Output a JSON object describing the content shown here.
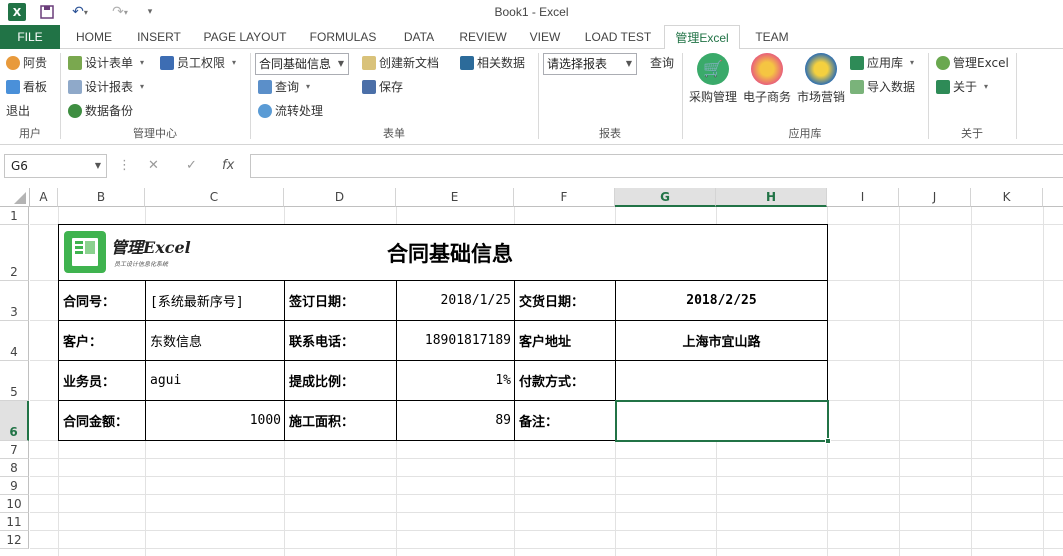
{
  "app": {
    "title": "Book1 - Excel"
  },
  "quick_access": {
    "excel_logo": "X",
    "save_icon": "save-icon",
    "undo_icon": "undo-icon",
    "redo_icon": "redo-icon",
    "customize_icon": "▾"
  },
  "tabs": [
    {
      "label": "FILE"
    },
    {
      "label": "HOME"
    },
    {
      "label": "INSERT"
    },
    {
      "label": "PAGE LAYOUT"
    },
    {
      "label": "FORMULAS"
    },
    {
      "label": "DATA"
    },
    {
      "label": "REVIEW"
    },
    {
      "label": "VIEW"
    },
    {
      "label": "LOAD TEST"
    },
    {
      "label": "管理Excel"
    },
    {
      "label": "TEAM"
    }
  ],
  "ribbon": {
    "user": {
      "btn1": "阿贵",
      "btn2": "看板",
      "btn3": "退出",
      "label": "用户"
    },
    "mgmt": {
      "design_form": "设计表单",
      "design_report": "设计报表",
      "backup": "数据备份",
      "permissions": "员工权限",
      "label": "管理中心"
    },
    "form": {
      "combo": "合同基础信息",
      "query": "查询",
      "flow": "流转处理",
      "new_doc": "创建新文档",
      "save": "保存",
      "related": "相关数据",
      "label": "表单"
    },
    "report": {
      "combo": "请选择报表",
      "query": "查询",
      "label": "报表"
    },
    "apps": {
      "purchase": "采购管理",
      "ecommerce": "电子商务",
      "marketing": "市场营销",
      "applib": "应用库",
      "import": "导入数据",
      "label": "应用库"
    },
    "about": {
      "manage_excel": "管理Excel",
      "about": "关于",
      "label": "关于"
    }
  },
  "formula_bar": {
    "name_box": "G6",
    "cancel_icon": "✕",
    "enter_icon": "✓",
    "fx": "fx",
    "content": ""
  },
  "columns": [
    "A",
    "B",
    "C",
    "D",
    "E",
    "F",
    "G",
    "H",
    "I",
    "J",
    "K"
  ],
  "rows": [
    "1",
    "2",
    "3",
    "4",
    "5",
    "6",
    "7",
    "8",
    "9",
    "10",
    "11",
    "12"
  ],
  "sheet": {
    "logo_text": "管理Excel",
    "logo_sub": "员工设计信息化系统",
    "title": "合同基础信息",
    "r3": {
      "b": "合同号：",
      "c": "[系统最新序号]",
      "d": "签订日期：",
      "e": "2018/1/25",
      "f": "交货日期：",
      "gh": "2018/2/25"
    },
    "r4": {
      "b": "客户：",
      "c": "东数信息",
      "d": "联系电话：",
      "e": "18901817189",
      "f": "客户地址",
      "gh": "上海市宜山路"
    },
    "r5": {
      "b": "业务员：",
      "c": "agui",
      "d": "提成比例：",
      "e": "1%",
      "f": "付款方式：",
      "gh": ""
    },
    "r6": {
      "b": "合同金额：",
      "c": "1000",
      "d": "施工面积：",
      "e": "89",
      "f": "备注：",
      "gh": ""
    }
  }
}
